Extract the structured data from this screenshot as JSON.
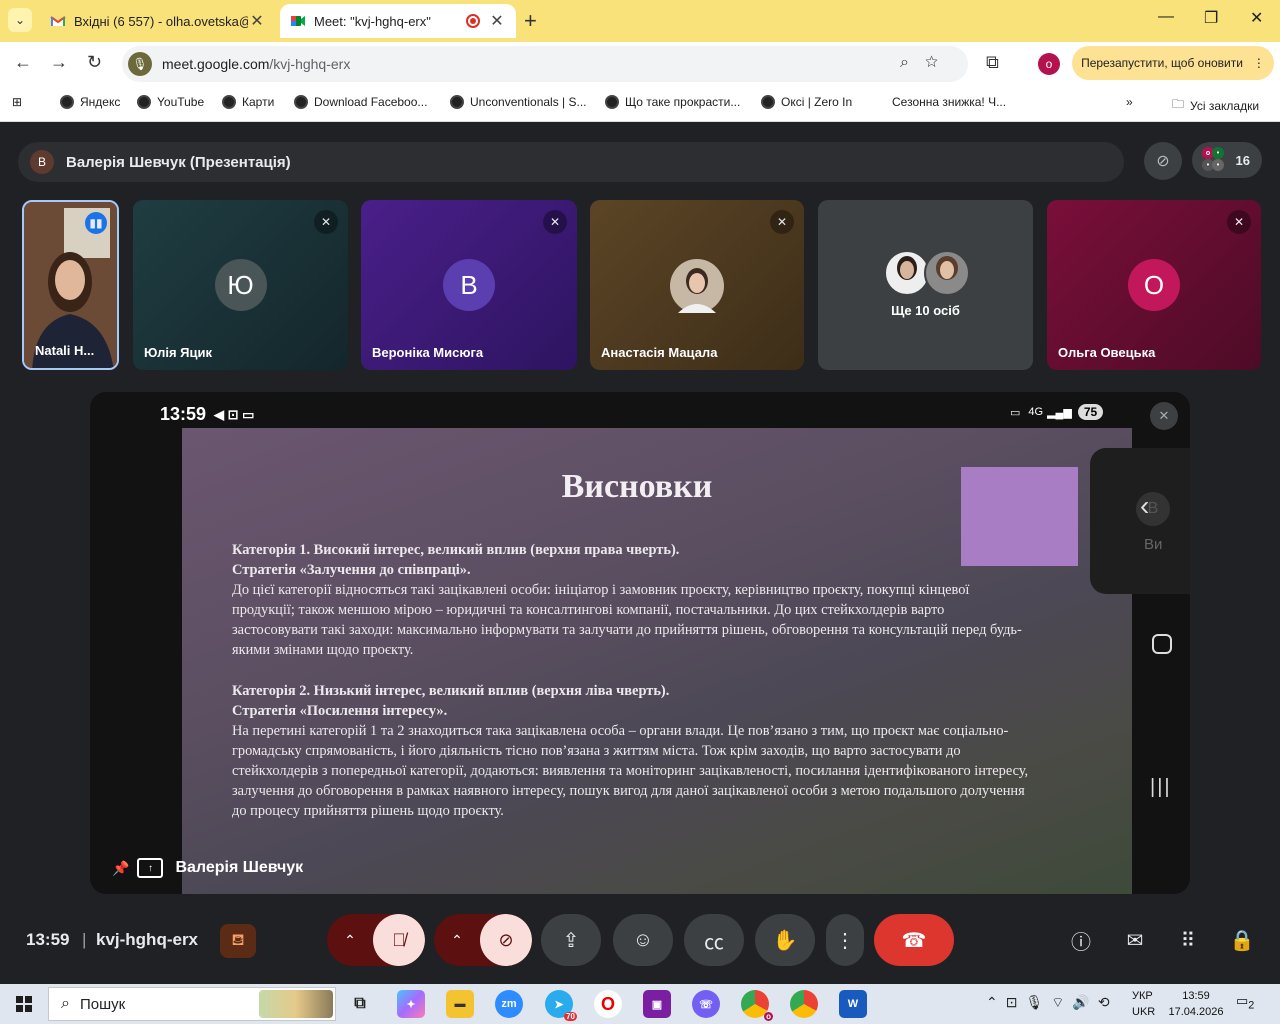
{
  "browser": {
    "tabs": [
      {
        "title": "Вхідні (6 557) - olha.ovetska@n",
        "close": "✕"
      },
      {
        "title": "Meet: \"kvj-hghq-erx\"",
        "close": "✕"
      }
    ],
    "new_tab": "+",
    "window_controls": {
      "minimize": "—",
      "restore": "❐",
      "close": "✕"
    },
    "url_host": "meet.google.com",
    "url_path": "/kvj-hghq-erx",
    "profile_letter": "o",
    "relaunch_label": "Перезапустити, щоб оновити",
    "bookmarks": [
      "Яндекс",
      "YouTube",
      "Карти",
      "Download Faceboo...",
      "Unconventionals | S...",
      "Що таке прокрасти...",
      "Оксі | Zero In",
      "Сезонна знижка! Ч..."
    ],
    "bookmarks_overflow": "»",
    "all_bookmarks": "Усі закладки"
  },
  "meet": {
    "presentation_title": "Валерія Шевчук (Презентація)",
    "presenter_initial": "В",
    "participant_count": "16",
    "tiles": [
      {
        "name": "Natali H...",
        "letter": ""
      },
      {
        "name": "Юлія Яцик",
        "letter": "Ю"
      },
      {
        "name": "Вероніка Мисюга",
        "letter": "В"
      },
      {
        "name": "Анастасія Мацала",
        "letter": ""
      },
      {
        "name": "Ще 10 осіб",
        "letter": ""
      },
      {
        "name": "Ольга Овецька",
        "letter": "О"
      }
    ],
    "phone_time": "13:59",
    "phone_network": "4G",
    "battery": "75",
    "side_you_label": "Ви",
    "side_you_initial": "В",
    "presenter_name": "Валерія Шевчук",
    "slide": {
      "title": "Висновки",
      "cat1_heading": "Категорія 1. Високий інтерес, великий вплив (верхня права чверть).",
      "cat1_strategy": "Стратегія «Залучення до співпраці».",
      "cat1_text": "До цієї категорії відносяться такі зацікавлені особи: ініціатор і замовник проєкту, керівництво проєкту, покупці кінцевої продукції; також меншою мірою – юридичні та консалтингові компанії, постачальники. До цих стейкхолдерів варто застосовувати такі заходи: максимально інформувати та залучати до прийняття рішень, обговорення та консультацій перед будь-якими змінами щодо проєкту.",
      "cat2_heading": "Категорія 2. Низький інтерес, великий вплив (верхня ліва чверть).",
      "cat2_strategy": "Стратегія «Посилення інтересу».",
      "cat2_text": "На перетині категорій 1 та 2 знаходиться така зацікавлена особа – органи влади. Це пов’язано з тим, що проєкт має соціально-громадську спрямованість, і його діяльність тісно пов’язана з життям міста. Тож крім заходів, що варто застосувати до стейкхолдерів з попередньої категорії, додаються: виявлення та моніторинг зацікавленості, посилання ідентифікованого інтересу, залучення до обговорення в рамках наявного інтересу, пошук вигод для даної зацікавленої особи з метою подальшого долучення до процесу прийняття рішень щодо проєкту."
    },
    "bottom_time": "13:59",
    "meeting_code": "kvj-hghq-erx"
  },
  "taskbar": {
    "search_placeholder": "Пошук",
    "telegram_badge": "70",
    "chrome_badge": "o",
    "lang_line1": "УКР",
    "lang_line2": "UKR",
    "clock_time": "13:59",
    "clock_date": "17.04.2026",
    "notif_count": "2"
  },
  "colors": {
    "tab_bar": "#f9e27a",
    "hangup": "#dc362e",
    "mic_off_bg": "#f9dedc",
    "slide_accent": "#a87dc4"
  }
}
